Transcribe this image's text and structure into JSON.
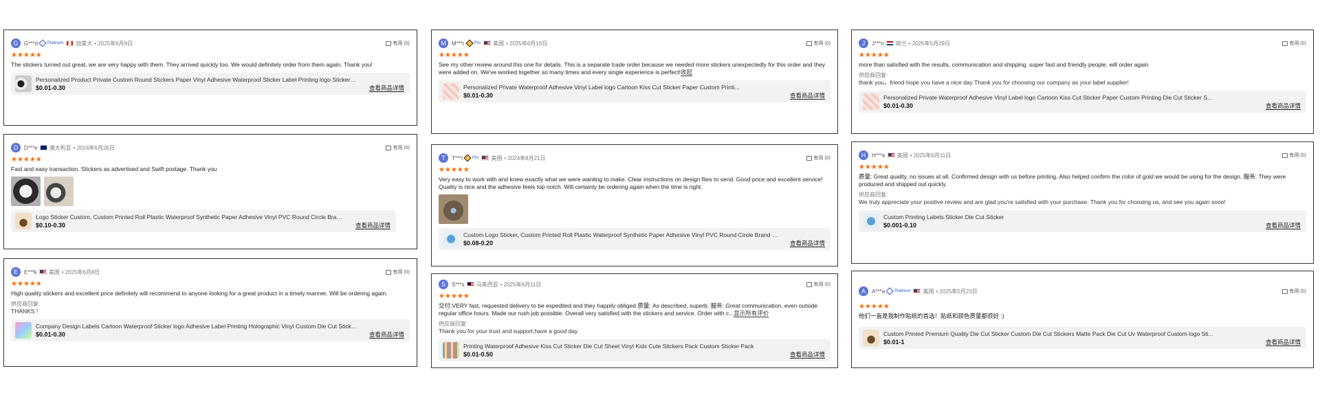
{
  "helpful_label": "有用 (0)",
  "detail_label": "查看商品详情",
  "reply_label": "供应商回复:",
  "collapse_label": "收起",
  "expand_label": "显示所有评价",
  "reviews": [
    {
      "avatar": "G",
      "user": "G***d",
      "badge": "Platinum",
      "flag": "ca",
      "country": "加拿大",
      "date": "2025年6月9日",
      "stars": "★★★★★",
      "text": "The stickers turned out great, we are very happy with them. They arrived quickly too. We would definitely order from them again. Thank you!",
      "product": "Personalized Product Private Custom Round Stickers Paper Vinyl Adhesive Waterproof Sticker Label Printing logo Sticker Roll",
      "price": "$0.01-0.30"
    },
    {
      "avatar": "D",
      "user": "D***e",
      "flag": "au",
      "country": "澳大利亚",
      "date": "2024年6月26日",
      "stars": "★★★★★",
      "text": "Fast and easy transaction. Stickers as advertised and Swift postage. Thank you",
      "product": "Logo Sticker Custom, Custom Printed Roll Plastic Waterproof Synthetic Paper Adhesive Vinyl PVC Round Circle Brand Logo S...",
      "price": "$0.10-0.30"
    },
    {
      "avatar": "E",
      "user": "E***k",
      "flag": "us",
      "country": "美国",
      "date": "2025年6月8日",
      "stars": "★★★★★",
      "text": "High quality stickers and excellent price definitely will recommend to anyone looking for a great product in a timely manner. Will be ordering again.",
      "reply": "THANKS !",
      "product": "Company Design Labels Cartoon Waterproof Sticker logo Adhesive Label Printing Holographic Vinyl Custom Die Cut Sticker S...",
      "price": "$0.01-0.30"
    },
    {
      "avatar": "M",
      "user": "M***r",
      "badge": "Pro",
      "flag": "us",
      "country": "美国",
      "date": "2025年6月16日",
      "stars": "★★★★★",
      "text": "See my other review around this one for details. This is a separate trade order because we needed more stickers unexpectedly for this order and they were added on. We've worked together so many times and every single experience is perfect!",
      "product": "Personalized Private Waterproof Adhesive Vinyl Label logo Cartoon Kiss Cut Sticker Paper Custom Printi...",
      "price": "$0.01-0.30"
    },
    {
      "avatar": "T",
      "user": "T***i",
      "badge": "Pro",
      "flag": "us",
      "country": "美国",
      "date": "2024年8月21日",
      "stars": "★★★★★",
      "text": "Very easy to work with and knew exactly what we were wanting to make. Clear instructions on design files to send. Good price and excellent service! Quality is nice and the adhesive feels top notch. Will certainly be ordering again when the time is right.",
      "product": "Custom Logo Sticker, Custom Printed Roll Plastic Waterproof Synthetic Paper Adhesive Vinyl PVC Round Circle Brand Logo S...",
      "price": "$0.08-0.20"
    },
    {
      "avatar": "S",
      "user": "S***s",
      "flag": "my",
      "country": "马来西亚",
      "date": "2025年6月11日",
      "stars": "★★★★★",
      "text": "交付:VERY fast, requested delivery to be expedited and they happily obliged 质量: As described, superb. 服务: Great communication, even outside regular office hours. Made our rush job possible. Overall very satisfied with the stickers and service. Order with c...",
      "reply": "Thank you for your trust and support,have a good day",
      "product": "Printing Waterproof Adhesive Kiss Cut Sticker Die Cut Sheet Vinyl Kids Cute Stickers Pack Custom Sticker Pack",
      "price": "$0.01-0.50"
    },
    {
      "avatar": "J",
      "user": "J***n",
      "flag": "nl",
      "country": "荷兰",
      "date": "2025年5月29日",
      "stars": "★★★★★",
      "text": "more than satisfied with the results, communication and shipping. super fast and friendly people. will order again",
      "reply": "thank you，friend hope you have a nice day Thank you for choosing our company as your label supplier!",
      "product": "Personalized Private Waterproof Adhesive Vinyl Label logo Cartoon Kiss Cut Sticker Paper Custom Printing Die Cut Sticker S...",
      "price": "$0.01-0.30"
    },
    {
      "avatar": "H",
      "user": "H***e",
      "flag": "us",
      "country": "美国",
      "date": "2025年6月11日",
      "stars": "★★★★★",
      "text": "质量: Great quality, no issues at all. Confirmed design with us before printing. Also helped confirm the color of gold we would be using for the design. 服务: They were produced and shipped out quickly.",
      "reply": "We truly appreciate your positive review and are glad you're satisfied with your purchase. Thank you for choosing us, and see you again soon!",
      "product": "Custom Printing Labels Sticker Die Cut Sticker",
      "price": "$0.001-0.10"
    },
    {
      "avatar": "A",
      "user": "A***a",
      "badge": "Platinum",
      "flag": "us",
      "country": "美国",
      "date": "2025年5月23日",
      "stars": "★★★★★",
      "text": "他们一直是我制作贴纸的首选！贴纸和颜色质量都很好 :)",
      "product": "Custom Printed Premium Quality Die Cut Sticker Custom Die Cut Stickers Matte Pack Die Cut Uv Waterproof Custom logo Sti...",
      "price": "$0.01-1"
    }
  ]
}
